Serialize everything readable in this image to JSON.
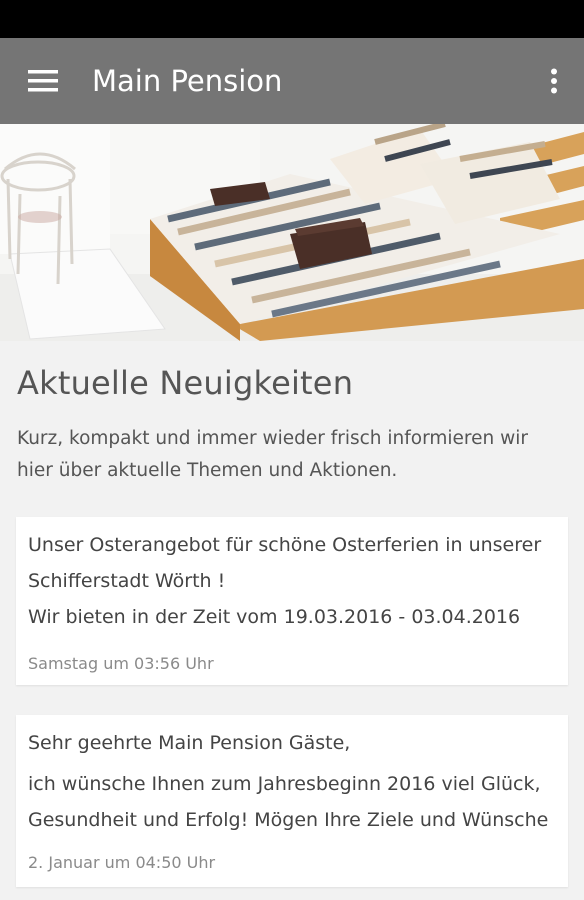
{
  "app_bar": {
    "title": "Main Pension",
    "menu_icon": "hamburger-menu-icon",
    "overflow_icon": "more-vert-icon",
    "background": "#757575"
  },
  "hero": {
    "description_icon": "bedroom-photo"
  },
  "news": {
    "title": "Aktuelle Neuigkeiten",
    "description_line1": "Kurz, kompakt und immer wieder frisch informieren wir",
    "description_line2": "hier über aktuelle Themen und Aktionen.",
    "posts": [
      {
        "line1": "Unser Osterangebot für schöne Osterferien in unserer",
        "line2": "Schifferstadt Wörth !",
        "line3": "Wir bieten in der Zeit vom 19.03.2016 - 03.04.2016",
        "date": "Samstag um 03:56 Uhr"
      },
      {
        "line1": "Sehr geehrte Main Pension Gäste,",
        "line2": "ich wünsche Ihnen zum Jahresbeginn 2016 viel Glück,",
        "line3": "Gesundheit und Erfolg! Mögen Ihre Ziele und Wünsche",
        "date": "2. Januar um 04:50 Uhr"
      }
    ]
  }
}
